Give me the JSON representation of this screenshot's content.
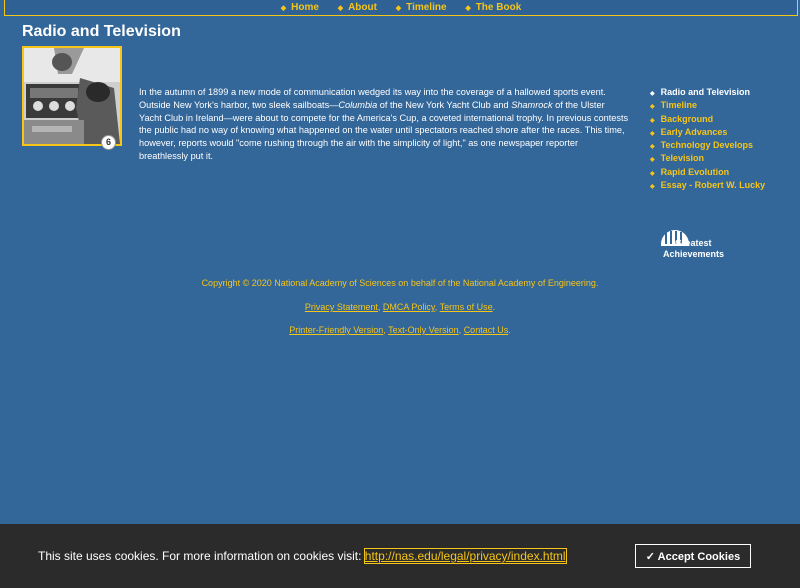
{
  "topnav": {
    "items": [
      {
        "label": "Home"
      },
      {
        "label": "About"
      },
      {
        "label": "Timeline"
      },
      {
        "label": "The Book"
      }
    ]
  },
  "page": {
    "title": "Radio and Television",
    "photo_badge": "6"
  },
  "intro": {
    "p1": "In the autumn of 1899 a new mode of communication wedged its way into the coverage of a hallowed sports event. Outside New York's harbor, two sleek sailboats—",
    "columbia": "Columbia",
    "p2": " of the New York Yacht Club and ",
    "shamrock": "Shamrock",
    "p3": " of the Ulster Yacht Club in Ireland—were about to compete for the America's Cup, a coveted international trophy. In previous contests the public had no way of knowing what happened on the water until spectators reached shore after the races. This time, however, reports would \"come rushing through the air with the simplicity of light,\" as one newspaper reporter breathlessly put it."
  },
  "sidenav": {
    "items": [
      {
        "label": "Radio and Television"
      },
      {
        "label": "Timeline"
      },
      {
        "label": "Background"
      },
      {
        "label": "Early Advances"
      },
      {
        "label": "Technology Develops"
      },
      {
        "label": "Television"
      },
      {
        "label": "Rapid Evolution"
      },
      {
        "label": "Essay - Robert W. Lucky"
      }
    ]
  },
  "logo": {
    "line1": "Greatest",
    "line2": "Achievements"
  },
  "footer": {
    "copyright": "Copyright © 2020 National Academy of Sciences on behalf of the National Academy of Engineering.",
    "privacy": "Privacy Statement",
    "dmca": "DMCA Policy",
    "terms": "Terms of Use",
    "printer": "Printer-Friendly Version",
    "textonly": "Text-Only Version",
    "contact": "Contact Us"
  },
  "cookie": {
    "text": "This site uses cookies. For more information on cookies visit: ",
    "link": "http://nas.edu/legal/privacy/index.html",
    "button": "✓ Accept Cookies"
  },
  "colors": {
    "background": "#336699",
    "accent": "#f5c518",
    "cookie_bar": "#2b2b2b"
  }
}
